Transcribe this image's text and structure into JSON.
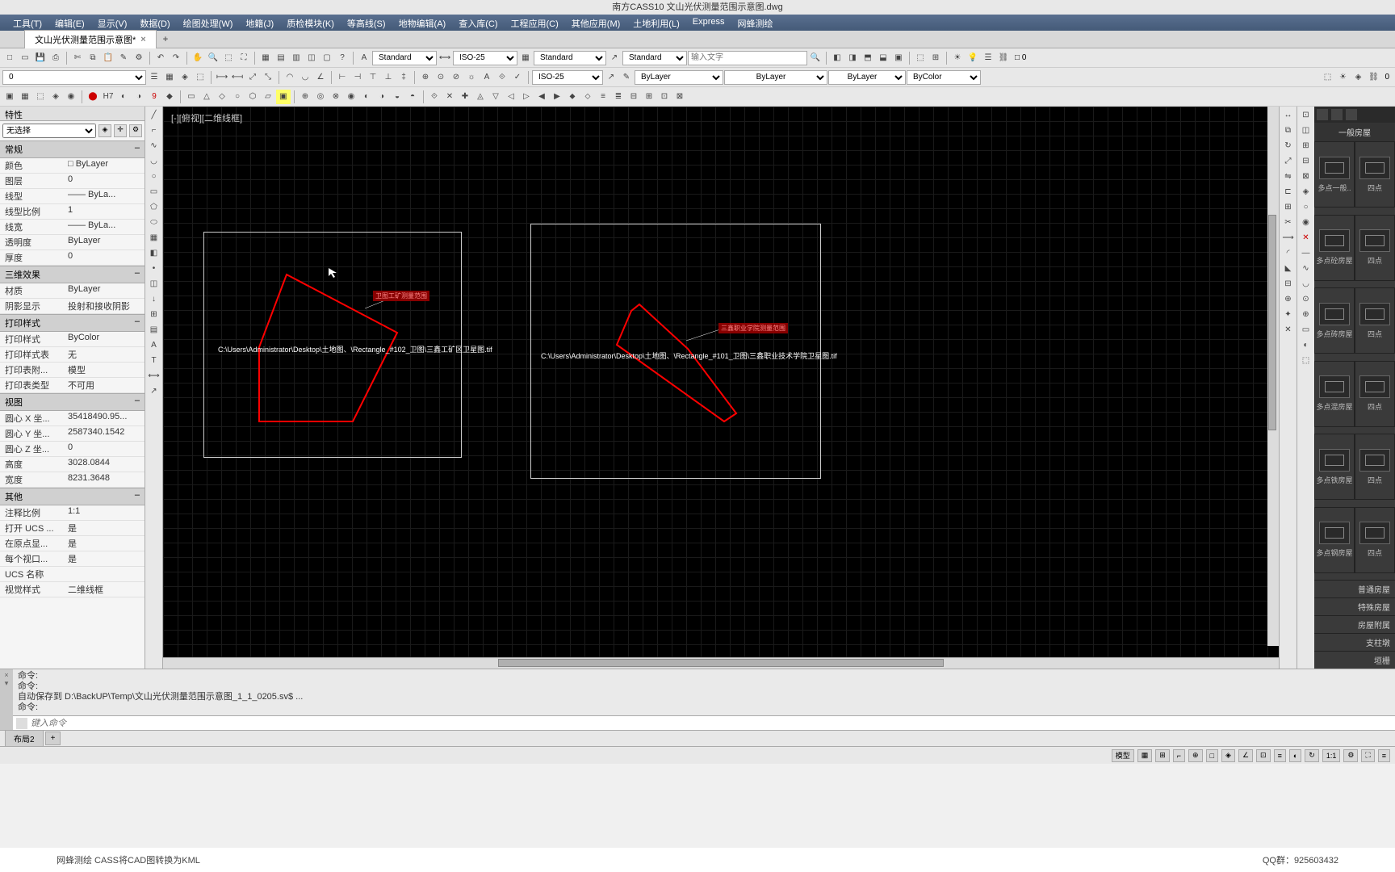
{
  "title": "南方CASS10   文山光伏测量范围示意图.dwg",
  "menu": [
    "工具(T)",
    "编辑(E)",
    "显示(V)",
    "数据(D)",
    "绘图处理(W)",
    "地籍(J)",
    "质检模块(K)",
    "等高线(S)",
    "地物编辑(A)",
    "查入库(C)",
    "工程应用(C)",
    "其他应用(M)",
    "土地利用(L)",
    "Express",
    "网蜂测绘"
  ],
  "tab": {
    "name": "文山光伏测量范围示意图*",
    "add": "+"
  },
  "tb1": {
    "style": "Standard",
    "dim": "ISO-25",
    "tstyle": "Standard",
    "mstyle": "Standard",
    "search_ph": "输入文字"
  },
  "tb2": {
    "z": "0",
    "dim": "ISO-25",
    "lay": "ByLayer",
    "lt": "ByLayer",
    "lw": "ByLayer",
    "col": "ByColor",
    "n": "0"
  },
  "prop": {
    "title": "特性",
    "sel": "无选择",
    "g1": "常规",
    "r1": [
      [
        "颜色",
        "□ ByLayer"
      ],
      [
        "图层",
        "0"
      ],
      [
        "线型",
        "—— ByLa..."
      ],
      [
        "线型比例",
        "1"
      ],
      [
        "线宽",
        "—— ByLa..."
      ],
      [
        "透明度",
        "ByLayer"
      ],
      [
        "厚度",
        "0"
      ]
    ],
    "g2": "三维效果",
    "r2": [
      [
        "材质",
        "ByLayer"
      ],
      [
        "阴影显示",
        "投射和接收阴影"
      ]
    ],
    "g3": "打印样式",
    "r3": [
      [
        "打印样式",
        "ByColor"
      ],
      [
        "打印样式表",
        "无"
      ],
      [
        "打印表附...",
        "模型"
      ],
      [
        "打印表类型",
        "不可用"
      ]
    ],
    "g4": "视图",
    "r4": [
      [
        "圆心 X 坐...",
        "35418490.95..."
      ],
      [
        "圆心 Y 坐...",
        "2587340.1542"
      ],
      [
        "圆心 Z 坐...",
        "0"
      ],
      [
        "高度",
        "3028.0844"
      ],
      [
        "宽度",
        "8231.3648"
      ]
    ],
    "g5": "其他",
    "r5": [
      [
        "注释比例",
        "1:1"
      ],
      [
        "打开 UCS ...",
        "是"
      ],
      [
        "在原点显...",
        "是"
      ],
      [
        "每个视口...",
        "是"
      ],
      [
        "UCS 名称",
        ""
      ],
      [
        "视觉样式",
        "二维线框"
      ]
    ]
  },
  "canvas": {
    "label": "[-][俯视][二维线框]",
    "path1": "C:\\Users\\Administrator\\Desktop\\土地图、\\Rectangle_#102_卫图\\三鑫工矿区卫星图.tif",
    "path2": "C:\\Users\\Administrator\\Desktop\\土地图、\\Rectangle_#101_卫图\\三鑫职业技术学院卫星图.tif",
    "label1": "卫图工矿测量范围",
    "label2": "三鑫职业学院测量范围"
  },
  "palette": {
    "title": "一般房屋",
    "items": [
      "多点一般..",
      "四点",
      "多点砼房屋",
      "四点",
      "多点砖房屋",
      "四点",
      "多点混房屋",
      "四点",
      "多点铁房屋",
      "四点",
      "多点钢房屋",
      "四点"
    ],
    "foot": [
      "普通房屋",
      "特殊房屋",
      "房屋附属",
      "支柱墩",
      "垣栅"
    ]
  },
  "cmd": {
    "l1": "命令:",
    "l2": "命令:",
    "l3": "自动保存到 D:\\BackUP\\Temp\\文山光伏测量范围示意图_1_1_0205.sv$ ...",
    "l4": "命令:",
    "ph": "键入命令"
  },
  "mtabs": [
    "布局2"
  ],
  "status": {
    "model": "模型",
    "scale": "1:1"
  },
  "footer": {
    "left": "网蜂测绘 CASS将CAD图转换为KML",
    "right": "QQ群：925603432"
  }
}
